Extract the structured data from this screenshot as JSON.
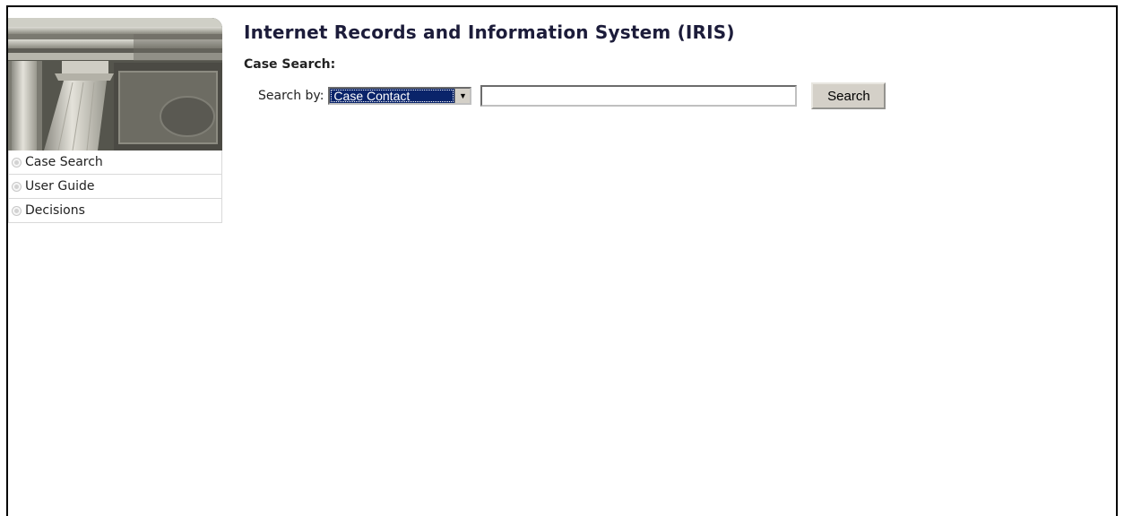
{
  "app": {
    "title": "Internet Records and Information System (IRIS)"
  },
  "sidebar": {
    "banner_image": "courthouse-columns-photo",
    "items": [
      {
        "label": "Case Search",
        "icon": "radio-bullet-icon"
      },
      {
        "label": "User Guide",
        "icon": "radio-bullet-icon"
      },
      {
        "label": "Decisions",
        "icon": "radio-bullet-icon"
      }
    ]
  },
  "search": {
    "heading": "Case Search:",
    "by_label": "Search by:",
    "selected_option": "Case Contact",
    "input_value": "",
    "button_label": "Search"
  },
  "colors": {
    "title": "#1c1c3a",
    "select_highlight": "#0a246a",
    "button_face": "#d4d0c8",
    "nav_border": "#d9d9d9"
  }
}
